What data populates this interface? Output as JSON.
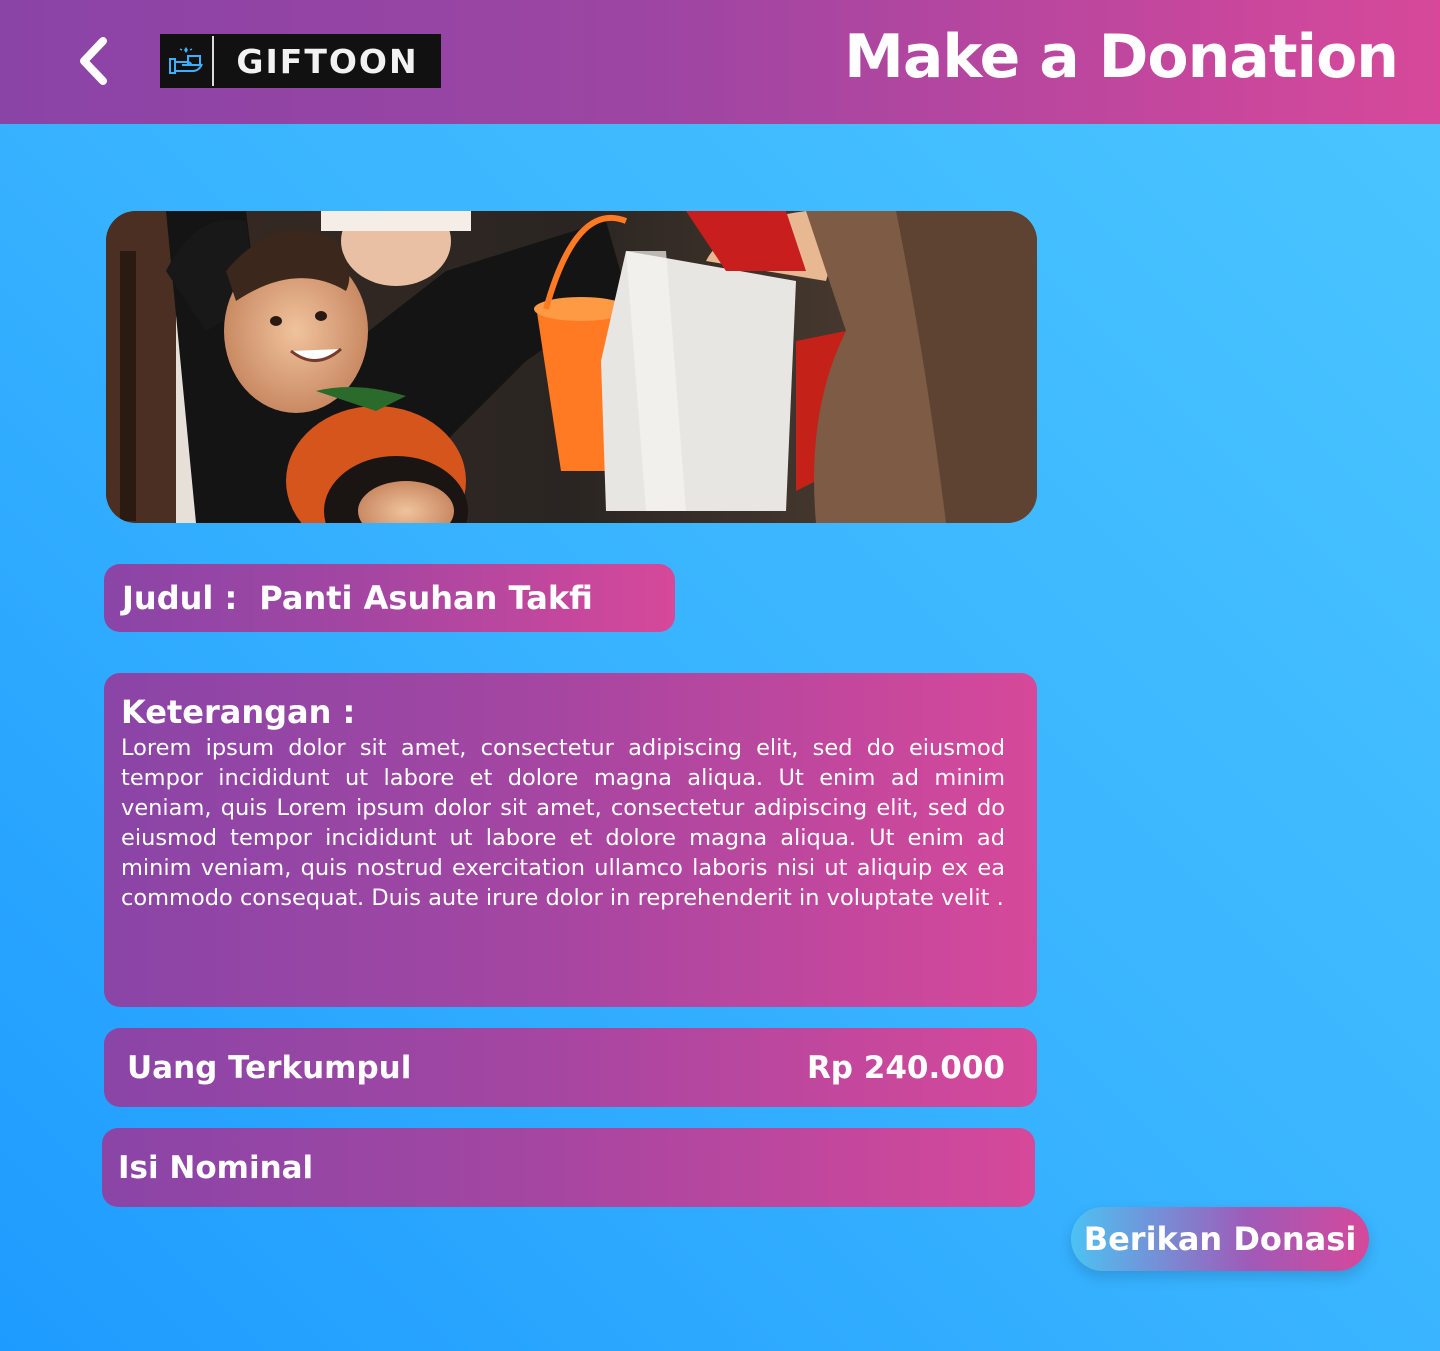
{
  "header": {
    "logo_text": "GIFTOON",
    "title": "Make a Donation"
  },
  "hero": {
    "image_icon": "photo-children-receiving-gifts"
  },
  "campaign": {
    "title_label": "Judul :",
    "title_value": "Panti Asuhan Takfi",
    "description_label": "Keterangan :",
    "description": "Lorem ipsum dolor sit amet, consectetur adipiscing elit, sed do eiusmod tempor incididunt ut labore et dolore magna aliqua. Ut enim ad minim veniam, quis Lorem ipsum dolor sit amet, consectetur adipiscing elit, sed do eiusmod tempor incididunt ut labore et dolore magna aliqua. Ut enim ad minim veniam, quis nostrud exercitation ullamco laboris nisi ut aliquip ex ea commodo consequat. Duis aute irure dolor in reprehenderit in voluptate velit .",
    "collected_label": "Uang Terkumpul",
    "collected_value": "Rp 240.000"
  },
  "form": {
    "nominal_placeholder": "Isi Nominal",
    "nominal_value": "",
    "submit_label": "Berikan Donasi"
  },
  "colors": {
    "header_gradient_start": "#8a44a6",
    "header_gradient_end": "#d7489a",
    "background": "#37b2ff",
    "accent_pink": "#d6489a"
  },
  "icons": {
    "back": "chevron-left-icon",
    "logo": "gift-hand-icon"
  }
}
